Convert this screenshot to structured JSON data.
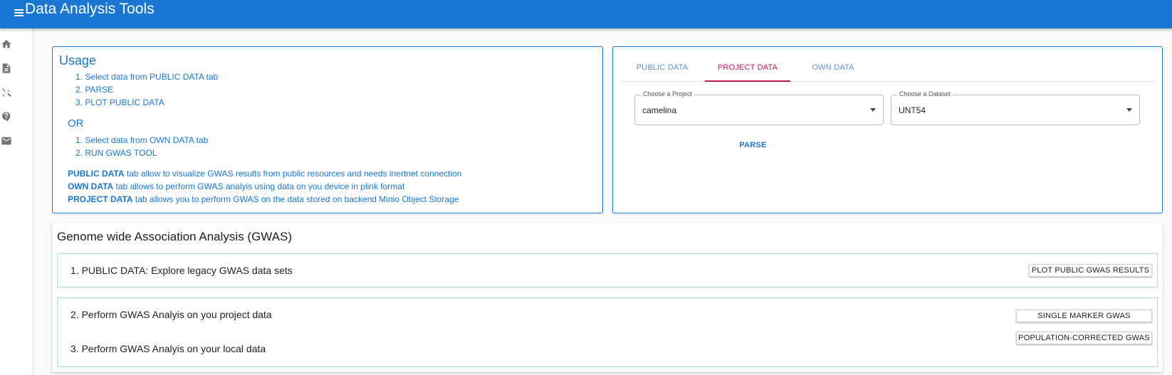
{
  "app": {
    "title": "Data Analysis Tools"
  },
  "sidebar": {
    "icons": [
      "home-icon",
      "document-icon",
      "tools-icon",
      "help-icon",
      "mail-icon"
    ]
  },
  "usage": {
    "title": "Usage",
    "steps1": [
      "1. Select data from PUBLIC DATA tab",
      "2. PARSE",
      "3. PLOT PUBLIC DATA"
    ],
    "or": "OR",
    "steps2": [
      "1. Select data from OWN DATA tab",
      "2. RUN GWAS TOOL"
    ],
    "notes": [
      {
        "bold": "PUBLIC DATA",
        "text": " tab allow to visualize GWAS results from public resources and needs inertnet connection"
      },
      {
        "bold": "OWN DATA",
        "text": " tab allows to perform GWAS analyis using data on you device in plink format"
      },
      {
        "bold": "PROJECT DATA",
        "text": " tab allows you to perform GWAS on the data stored on backend Minio Object Storage"
      }
    ]
  },
  "panel": {
    "tabs": [
      "PUBLIC DATA",
      "PROJECT DATA",
      "OWN DATA"
    ],
    "active_tab": "PROJECT DATA",
    "project_select": {
      "label": "Choose a Project",
      "value": "camelina"
    },
    "dataset_select": {
      "label": "Choose a Dataset",
      "value": "UNT54"
    },
    "parse_label": "PARSE"
  },
  "gwas": {
    "title": "Genome wide Association Analysis (GWAS)",
    "card1": {
      "text": "1. PUBLIC DATA: Explore legacy GWAS data sets",
      "button": "PLOT PUBLIC GWAS RESULTS"
    },
    "card2": {
      "text1": "2. Perform GWAS Analyis on you project data",
      "text2": "3. Perform GWAS Analyis on your local data",
      "button1": "SINGLE MARKER GWAS",
      "button2": "POPULATION-CORRECTED GWAS"
    }
  },
  "colors": {
    "primary": "#1976d2",
    "active_tab": "#c2185b",
    "card_border": "#b2dbe8"
  }
}
